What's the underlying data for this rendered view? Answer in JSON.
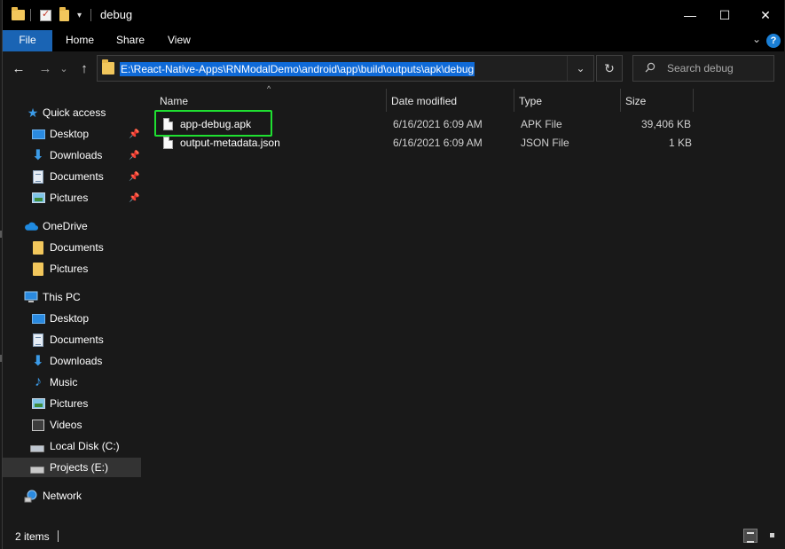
{
  "titlebar": {
    "title": "debug",
    "controls": {
      "minimize": "—",
      "maximize": "☐",
      "close": "✕"
    }
  },
  "ribbon": {
    "tabs": [
      {
        "label": "File"
      },
      {
        "label": "Home"
      },
      {
        "label": "Share"
      },
      {
        "label": "View"
      }
    ],
    "help": "?"
  },
  "nav": {
    "back": "←",
    "forward": "→",
    "recent": "⌄",
    "up": "↑",
    "address": "E:\\React-Native-Apps\\RNModalDemo\\android\\app\\build\\outputs\\apk\\debug",
    "refresh": "↻",
    "search_placeholder": "Search debug"
  },
  "sidebar": {
    "quick_access": "Quick access",
    "quick_items": [
      "Desktop",
      "Downloads",
      "Documents",
      "Pictures"
    ],
    "onedrive": "OneDrive",
    "onedrive_items": [
      "Documents",
      "Pictures"
    ],
    "this_pc": "This PC",
    "pc_items": [
      "Desktop",
      "Documents",
      "Downloads",
      "Music",
      "Pictures",
      "Videos",
      "Local Disk (C:)",
      "Projects (E:)"
    ],
    "network": "Network"
  },
  "columns": {
    "name": "Name",
    "date": "Date modified",
    "type": "Type",
    "size": "Size"
  },
  "files": [
    {
      "name": "app-debug.apk",
      "date": "6/16/2021 6:09 AM",
      "type": "APK File",
      "size": "39,406 KB"
    },
    {
      "name": "output-metadata.json",
      "date": "6/16/2021 6:09 AM",
      "type": "JSON File",
      "size": "1 KB"
    }
  ],
  "status": {
    "count": "2 items"
  },
  "colors": {
    "accent": "#1a64b4",
    "selection": "#0f6ad8",
    "highlight": "#1fe031",
    "background": "#191919"
  },
  "icons": {
    "folder": "folder-icon",
    "star": "star-icon",
    "pin": "pin-icon",
    "cloud": "cloud-icon",
    "pc": "computer-icon",
    "network": "network-icon",
    "file": "file-icon",
    "search": "search-icon"
  }
}
